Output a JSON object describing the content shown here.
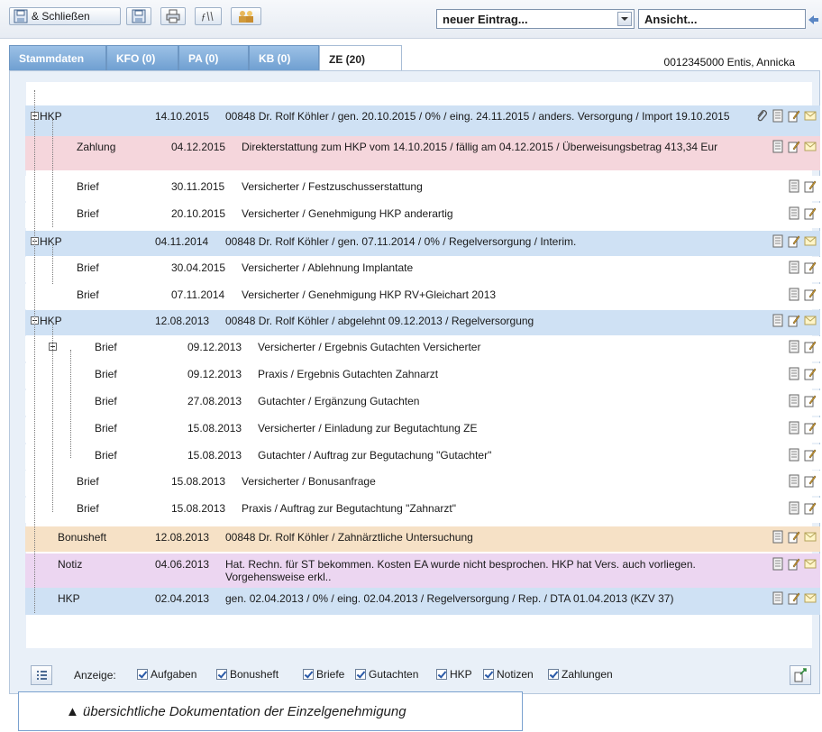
{
  "toolbar": {
    "save_close_label": "& Schließen",
    "entry_combo": "neuer Eintrag...",
    "view_combo": "Ansicht..."
  },
  "tabs": [
    {
      "label": "Stammdaten"
    },
    {
      "label": "KFO (0)"
    },
    {
      "label": "PA (0)"
    },
    {
      "label": "KB (0)"
    },
    {
      "label": "ZE (20)"
    }
  ],
  "patient": "0012345000 Entis, Annicka",
  "rows": [
    {
      "type": "HKP",
      "date": "14.10.2015",
      "desc": "00848 Dr. Rolf Köhler / gen. 20.10.2015 / 0% / eing. 24.11.2015 / anders. Versorgung / Import 19.10.2015"
    },
    {
      "type": "Zahlung",
      "date": "04.12.2015",
      "desc": "Direkterstattung zum HKP vom 14.10.2015 / fällig am 04.12.2015 / Überweisungsbetrag 413,34 Eur"
    },
    {
      "type": "Brief",
      "date": "30.11.2015",
      "desc": "Versicherter / Festzuschusserstattung"
    },
    {
      "type": "Brief",
      "date": "20.10.2015",
      "desc": "Versicherter / Genehmigung HKP anderartig"
    },
    {
      "type": "HKP",
      "date": "04.11.2014",
      "desc": "00848 Dr. Rolf Köhler / gen. 07.11.2014 / 0% / Regelversorgung / Interim."
    },
    {
      "type": "Brief",
      "date": "30.04.2015",
      "desc": "Versicherter / Ablehnung Implantate"
    },
    {
      "type": "Brief",
      "date": "07.11.2014",
      "desc": "Versicherter / Genehmigung HKP RV+Gleichart 2013"
    },
    {
      "type": "HKP",
      "date": "12.08.2013",
      "desc": "00848 Dr. Rolf Köhler / abgelehnt 09.12.2013 / Regelversorgung"
    },
    {
      "type": "Brief",
      "date": "09.12.2013",
      "desc": "Versicherter / Ergebnis Gutachten Versicherter"
    },
    {
      "type": "Brief",
      "date": "09.12.2013",
      "desc": "Praxis / Ergebnis Gutachten Zahnarzt"
    },
    {
      "type": "Brief",
      "date": "27.08.2013",
      "desc": "Gutachter / Ergänzung Gutachten"
    },
    {
      "type": "Brief",
      "date": "15.08.2013",
      "desc": "Versicherter / Einladung zur Begutachtung ZE"
    },
    {
      "type": "Brief",
      "date": "15.08.2013",
      "desc": "Gutachter / Auftrag zur Begutachung \"Gutachter\""
    },
    {
      "type": "Brief",
      "date": "15.08.2013",
      "desc": "Versicherter / Bonusanfrage"
    },
    {
      "type": "Brief",
      "date": "15.08.2013",
      "desc": "Praxis / Auftrag zur Begutachtung \"Zahnarzt\""
    },
    {
      "type": "Bonusheft",
      "date": "12.08.2013",
      "desc": "00848 Dr. Rolf Köhler / Zahnärztliche Untersuchung"
    },
    {
      "type": "Notiz",
      "date": "04.06.2013",
      "desc": "Hat. Rechn. für ST bekommen. Kosten EA wurde nicht besprochen. HKP hat Vers. auch vorliegen. Vorgehensweise erkl.."
    },
    {
      "type": "HKP",
      "date": "02.04.2013",
      "desc": "gen. 02.04.2013 / 0% / eing. 02.04.2013 / Regelversorgung / Rep. / DTA 01.04.2013 (KZV 37)"
    }
  ],
  "filter": {
    "label": "Anzeige:",
    "options": [
      "Aufgaben",
      "Bonusheft",
      "Briefe",
      "Gutachten",
      "HKP",
      "Notizen",
      "Zahlungen"
    ]
  },
  "caption": "▲ übersichtliche Dokumentation der Einzelgenehmigung"
}
